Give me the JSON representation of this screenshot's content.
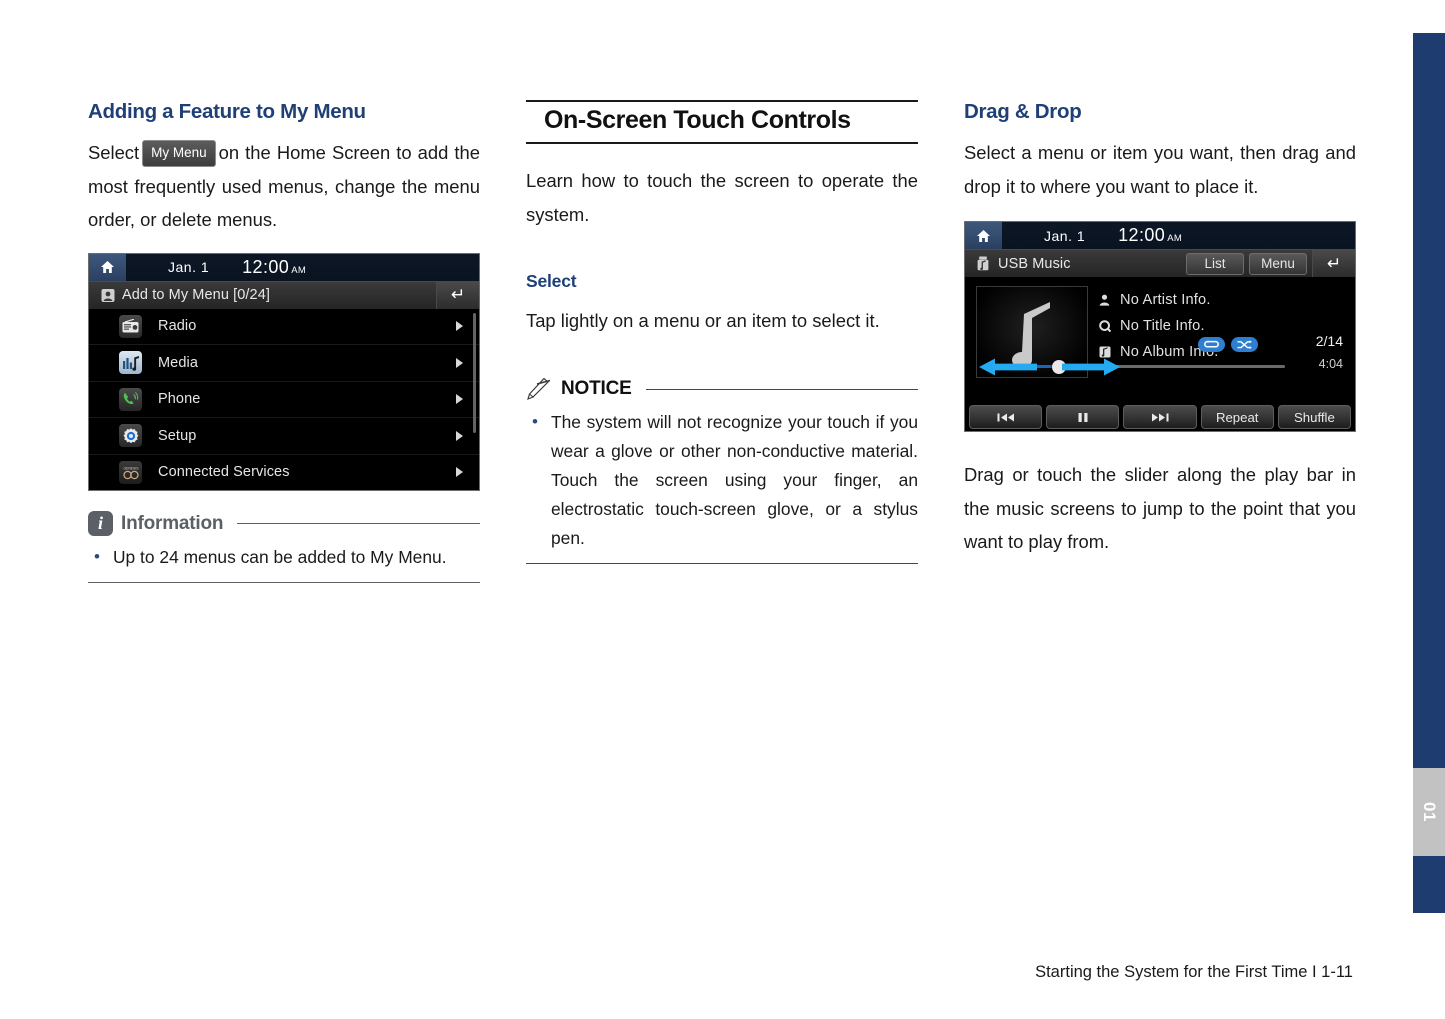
{
  "page": {
    "footer": "Starting the System for the First Time I 1-11",
    "side_tab_label": "01"
  },
  "left_column": {
    "heading": "Adding a Feature to My Menu",
    "paragraph_part1": "Select",
    "inline_button": "My Menu",
    "paragraph_part2": "on the Home Screen to add the most frequently used menus, change the menu order, or delete menus.",
    "info_callout": {
      "icon": "info-icon",
      "label": "Information",
      "bullets": [
        "Up to 24 menus can be added to My Menu."
      ]
    },
    "screenshot": {
      "status_bar": {
        "home_icon": "home-icon",
        "date": "Jan.  1",
        "time": "12:00",
        "ampm": "AM"
      },
      "title_bar": {
        "icon": "add-to-my-menu-icon",
        "title": "Add to My Menu [0/24]",
        "back_icon": "back-arrow-icon"
      },
      "rows": [
        {
          "icon": "radio-icon",
          "label": "Radio",
          "arrow": "chevron-right-icon"
        },
        {
          "icon": "media-icon",
          "label": "Media",
          "arrow": "chevron-right-icon"
        },
        {
          "icon": "phone-icon",
          "label": "Phone",
          "arrow": "chevron-right-icon"
        },
        {
          "icon": "setup-icon",
          "label": "Setup",
          "arrow": "chevron-right-icon"
        },
        {
          "icon": "genesis-connected-services-icon",
          "label": "Connected Services",
          "arrow": "chevron-right-icon"
        }
      ]
    }
  },
  "middle_column": {
    "title": "On-Screen Touch Controls",
    "intro": "Learn how to touch the screen to operate the system.",
    "subsection": {
      "heading": "Select",
      "paragraph": "Tap lightly on a menu or an item to select it."
    },
    "notice_callout": {
      "icon": "pencil-icon",
      "label": "NOTICE",
      "bullets": [
        "The system will not recognize your touch if you wear a glove or other non-conductive material. Touch the screen using your finger, an electrostatic touch-screen glove, or a stylus pen."
      ]
    }
  },
  "right_column": {
    "heading": "Drag & Drop",
    "paragraph": "Select a menu or item you want, then drag and drop it to where you want to place it.",
    "paragraph_below": "Drag or touch the slider along the play bar in the music screens to jump to the point that you want to play from.",
    "screenshot": {
      "status_bar": {
        "home_icon": "home-icon",
        "date": "Jan.  1",
        "time": "12:00",
        "ampm": "AM"
      },
      "title_bar": {
        "icon": "usb-icon",
        "title": "USB Music",
        "buttons": [
          "List",
          "Menu"
        ],
        "back_icon": "back-arrow-icon"
      },
      "album_art_icon": "music-note-icon",
      "metadata": [
        {
          "icon": "artist-icon",
          "text": "No Artist Info."
        },
        {
          "icon": "title-icon",
          "text": "No Title Info."
        },
        {
          "icon": "album-icon",
          "text": "No Album Info."
        }
      ],
      "badges": [
        "repeat-icon",
        "shuffle-icon"
      ],
      "track_position": "2/14",
      "track_time": "4:04",
      "controls": [
        {
          "icon": "previous-track-icon",
          "label": ""
        },
        {
          "icon": "pause-icon",
          "label": ""
        },
        {
          "icon": "next-track-icon",
          "label": ""
        },
        {
          "icon": "",
          "label": "Repeat"
        },
        {
          "icon": "",
          "label": "Shuffle"
        }
      ]
    }
  },
  "colors": {
    "heading_blue": "#1f3f77",
    "edge_band": "#1e3c70",
    "tab_gray": "#c2c2c2",
    "notice_rule": "#2a4b80",
    "info_gray": "#5b6066",
    "accent_blue": "#2f7fd1"
  }
}
